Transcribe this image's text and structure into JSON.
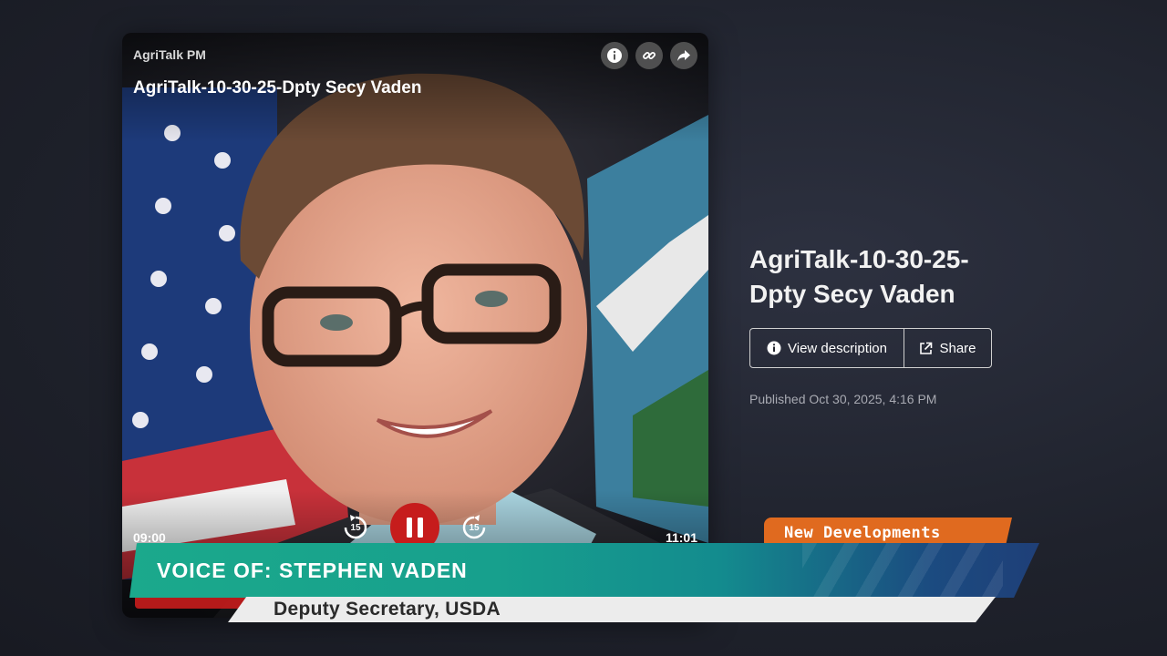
{
  "player": {
    "show_name": "AgriTalk PM",
    "episode_title": "AgriTalk-10-30-25-Dpty Secy Vaden",
    "icons": [
      "info-icon",
      "link-icon",
      "share-arrow-icon"
    ],
    "elapsed": "09:00",
    "duration": "11:01",
    "skip_back_seconds": "15",
    "skip_forward_seconds": "15",
    "accent_color": "#c61c1c"
  },
  "info": {
    "title": "AgriTalk-10-30-25-Dpty Secy Vaden",
    "view_description_label": "View description",
    "share_label": "Share",
    "published": "Published Oct 30, 2025, 4:16 PM"
  },
  "overlay": {
    "tag": "New Developments",
    "tag_color": "#e06a1f",
    "name_line": "VOICE OF: STEPHEN VADEN",
    "title_line": "Deputy Secretary, USDA"
  }
}
